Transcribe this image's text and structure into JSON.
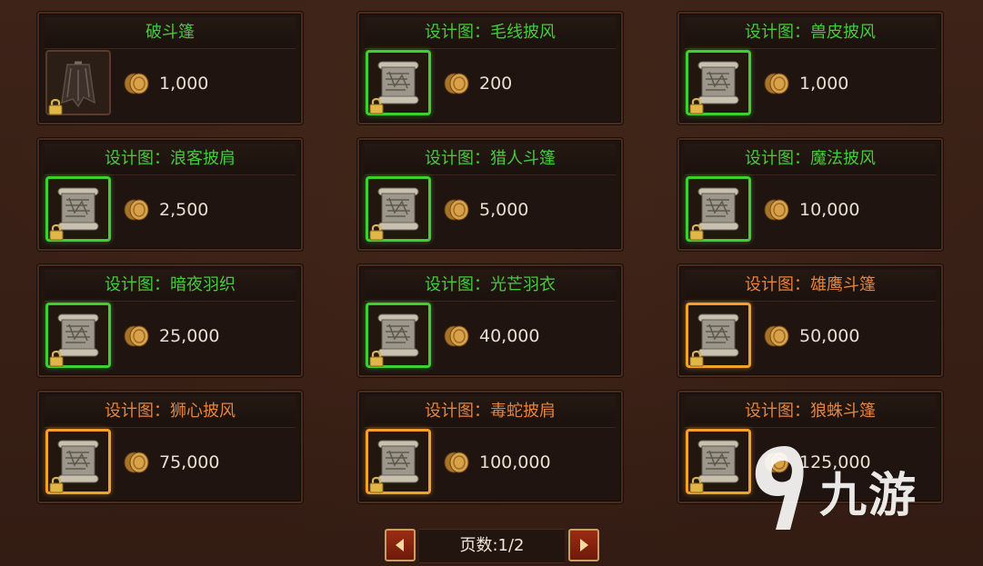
{
  "items": [
    {
      "title": "破斗篷",
      "price": "1,000",
      "frame": "plain",
      "title_color": "green",
      "icon": "cloak-icon"
    },
    {
      "title": "设计图：毛线披风",
      "price": "200",
      "frame": "green",
      "title_color": "green",
      "icon": "scroll-icon"
    },
    {
      "title": "设计图：兽皮披风",
      "price": "1,000",
      "frame": "green",
      "title_color": "green",
      "icon": "scroll-icon"
    },
    {
      "title": "设计图：浪客披肩",
      "price": "2,500",
      "frame": "green",
      "title_color": "green",
      "icon": "scroll-icon"
    },
    {
      "title": "设计图：猎人斗篷",
      "price": "5,000",
      "frame": "green",
      "title_color": "green",
      "icon": "scroll-icon"
    },
    {
      "title": "设计图：魔法披风",
      "price": "10,000",
      "frame": "green",
      "title_color": "green",
      "icon": "scroll-icon"
    },
    {
      "title": "设计图：暗夜羽织",
      "price": "25,000",
      "frame": "green",
      "title_color": "green",
      "icon": "scroll-icon"
    },
    {
      "title": "设计图：光芒羽衣",
      "price": "40,000",
      "frame": "green",
      "title_color": "green",
      "icon": "scroll-icon"
    },
    {
      "title": "设计图：雄鹰斗篷",
      "price": "50,000",
      "frame": "orange",
      "title_color": "orange",
      "icon": "scroll-icon"
    },
    {
      "title": "设计图：狮心披风",
      "price": "75,000",
      "frame": "orange",
      "title_color": "orange",
      "icon": "scroll-icon"
    },
    {
      "title": "设计图：毒蛇披肩",
      "price": "100,000",
      "frame": "orange",
      "title_color": "orange",
      "icon": "scroll-icon"
    },
    {
      "title": "设计图：狼蛛斗篷",
      "price": "125,000",
      "frame": "orange",
      "title_color": "orange",
      "icon": "scroll-icon"
    }
  ],
  "pager": {
    "label": "页数:1/2",
    "prev_icon": "left-arrow-icon",
    "next_icon": "right-arrow-icon"
  },
  "watermark": {
    "text": "九游",
    "icon": "jiuyou-logo-icon"
  },
  "colors": {
    "green": "#47c93f",
    "orange": "#e38440",
    "coin": "#c9912f"
  }
}
